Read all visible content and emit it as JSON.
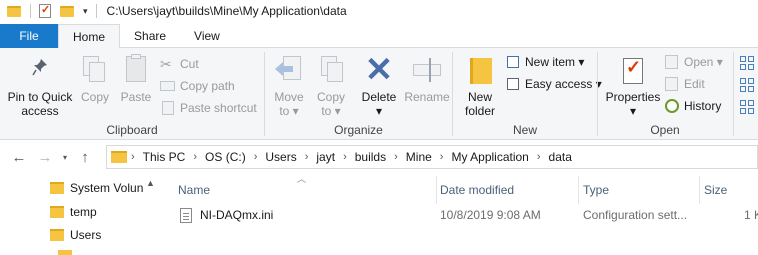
{
  "title_bar": {
    "path": "C:\\Users\\jayt\\builds\\Mine\\My Application\\data"
  },
  "tabs": [
    "File",
    "Home",
    "Share",
    "View"
  ],
  "ribbon": {
    "clipboard": {
      "label": "Clipboard",
      "pin_to_quick_access": "Pin to Quick\naccess",
      "copy": "Copy",
      "paste": "Paste",
      "cut": "Cut",
      "copy_path": "Copy path",
      "paste_shortcut": "Paste shortcut"
    },
    "organize": {
      "label": "Organize",
      "move_to": "Move\nto ▾",
      "copy_to": "Copy\nto ▾",
      "delete": "Delete\n▾",
      "rename": "Rename"
    },
    "new": {
      "label": "New",
      "new_folder": "New\nfolder",
      "new_item": "New item ▾",
      "easy_access": "Easy access ▾"
    },
    "open": {
      "label": "Open",
      "properties": "Properties\n▾",
      "open": "Open ▾",
      "edit": "Edit",
      "history": "History"
    }
  },
  "address_bar": {
    "crumbs": [
      "This PC",
      "OS (C:)",
      "Users",
      "jayt",
      "builds",
      "Mine",
      "My Application",
      "data"
    ]
  },
  "nav_pane": {
    "items": [
      "System Volun",
      "temp",
      "Users"
    ]
  },
  "file_list": {
    "columns": [
      "Name",
      "Date modified",
      "Type",
      "Size"
    ],
    "rows": [
      {
        "name": "NI-DAQmx.ini",
        "date": "10/8/2019 9:08 AM",
        "type": "Configuration sett...",
        "size": "1 K"
      }
    ]
  },
  "colors": {
    "file_tab": "#1979ca",
    "folder": "#f5c542",
    "ribbon_bg": "#f5f6f7"
  }
}
